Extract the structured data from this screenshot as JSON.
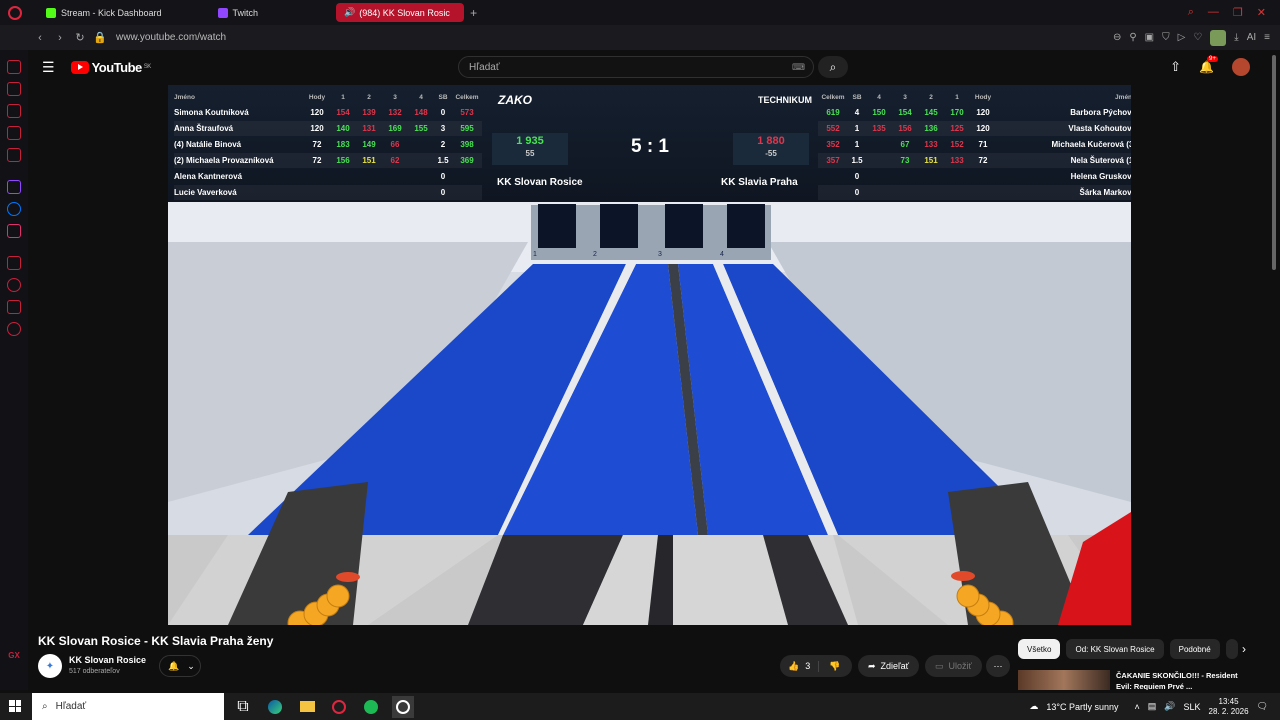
{
  "browser": {
    "tabs": [
      {
        "label": "Stream - Kick Dashboard",
        "color": "#53fc18"
      },
      {
        "label": "Twitch",
        "color": "#9146ff"
      },
      {
        "label": "(984) KK Slovan Rosic",
        "color": "#ff0000",
        "active": true
      }
    ],
    "url": "www.youtube.com/watch",
    "ai_label": "AI"
  },
  "youtube": {
    "logo_text": "YouTube",
    "region": "SK",
    "search_placeholder": "Hľadať",
    "notif_count": "9+"
  },
  "scoreboard": {
    "home": {
      "team": "KK Slovan Rosice",
      "sponsor": "ZAKO",
      "total": "1 935",
      "diff": "55",
      "header": [
        "Jméno",
        "Hody",
        "1",
        "2",
        "3",
        "4",
        "SB",
        "Celkem"
      ],
      "players": [
        {
          "name": "Simona Koutníková",
          "hody": "120",
          "s1": "154",
          "s2": "139",
          "s3": "132",
          "s4": "148",
          "sb": "0",
          "total": "573",
          "c": [
            "r",
            "r",
            "r",
            "r"
          ],
          "tc": "r"
        },
        {
          "name": "Anna Štraufová",
          "hody": "120",
          "s1": "140",
          "s2": "131",
          "s3": "169",
          "s4": "155",
          "sb": "3",
          "total": "595",
          "c": [
            "g",
            "r",
            "g",
            "g"
          ],
          "tc": "g"
        },
        {
          "name": "(4)  Natálie Binová",
          "hody": "72",
          "s1": "183",
          "s2": "149",
          "s3": "66",
          "s4": "",
          "sb": "2",
          "total": "398",
          "c": [
            "g",
            "g",
            "r",
            ""
          ],
          "tc": "g"
        },
        {
          "name": "(2)  Michaela Provazníková",
          "hody": "72",
          "s1": "156",
          "s2": "151",
          "s3": "62",
          "s4": "",
          "sb": "1.5",
          "total": "369",
          "c": [
            "g",
            "y",
            "r",
            ""
          ],
          "tc": "g"
        },
        {
          "name": "Alena Kantnerová",
          "hody": "",
          "s1": "",
          "s2": "",
          "s3": "",
          "s4": "",
          "sb": "0",
          "total": "",
          "c": [
            "",
            "",
            "",
            ""
          ],
          "tc": ""
        },
        {
          "name": "Lucie Vaverková",
          "hody": "",
          "s1": "",
          "s2": "",
          "s3": "",
          "s4": "",
          "sb": "0",
          "total": "",
          "c": [
            "",
            "",
            "",
            ""
          ],
          "tc": ""
        }
      ]
    },
    "away": {
      "team": "KK Slavia Praha",
      "sponsor": "TECHNIKUM",
      "total": "1 880",
      "diff": "-55",
      "header": [
        "Celkem",
        "SB",
        "4",
        "3",
        "2",
        "1",
        "Hody",
        "Jméno"
      ],
      "players": [
        {
          "name": "Barbora Pýchová",
          "hody": "120",
          "s1": "170",
          "s2": "145",
          "s3": "154",
          "s4": "150",
          "sb": "4",
          "total": "619",
          "c": [
            "g",
            "g",
            "g",
            "g"
          ],
          "tc": "g"
        },
        {
          "name": "Vlasta Kohoutová",
          "hody": "120",
          "s1": "125",
          "s2": "136",
          "s3": "156",
          "s4": "135",
          "sb": "1",
          "total": "552",
          "c": [
            "r",
            "g",
            "r",
            "r"
          ],
          "tc": "r"
        },
        {
          "name": "Michaela Kučerová  (3)",
          "hody": "71",
          "s1": "152",
          "s2": "133",
          "s3": "67",
          "s4": "",
          "sb": "1",
          "total": "352",
          "c": [
            "r",
            "r",
            "g",
            ""
          ],
          "tc": "r"
        },
        {
          "name": "Nela Šuterová  (1)",
          "hody": "72",
          "s1": "133",
          "s2": "151",
          "s3": "73",
          "s4": "",
          "sb": "1.5",
          "total": "357",
          "c": [
            "r",
            "y",
            "g",
            ""
          ],
          "tc": "r"
        },
        {
          "name": "Helena Grusková",
          "hody": "",
          "s1": "",
          "s2": "",
          "s3": "",
          "s4": "",
          "sb": "0",
          "total": "",
          "c": [
            "",
            "",
            "",
            ""
          ],
          "tc": ""
        },
        {
          "name": "Šárka Marková",
          "hody": "",
          "s1": "",
          "s2": "",
          "s3": "",
          "s4": "",
          "sb": "0",
          "total": "",
          "c": [
            "",
            "",
            "",
            ""
          ],
          "tc": ""
        }
      ]
    },
    "score": "5 : 1",
    "lane_numbers": [
      "1",
      "2",
      "3",
      "4"
    ]
  },
  "video_meta": {
    "title": "KK Slovan Rosice - KK Slavia Praha ženy",
    "channel": "KK Slovan Rosice",
    "subscribers": "517 odberateľov",
    "likes": "3",
    "share": "Zdieľať",
    "save": "Uložiť"
  },
  "chips": [
    "Všetko",
    "Od: KK Slovan Rosice",
    "Podobné"
  ],
  "recommendation": {
    "title": "ČAKANIE SKONČILO!!! - Resident Evil: Requiem Prvé ..."
  },
  "taskbar": {
    "search_placeholder": "Hľadať",
    "weather": "13°C  Partly sunny",
    "lang": "SLK",
    "time": "13:45",
    "date": "28. 2. 2026"
  }
}
